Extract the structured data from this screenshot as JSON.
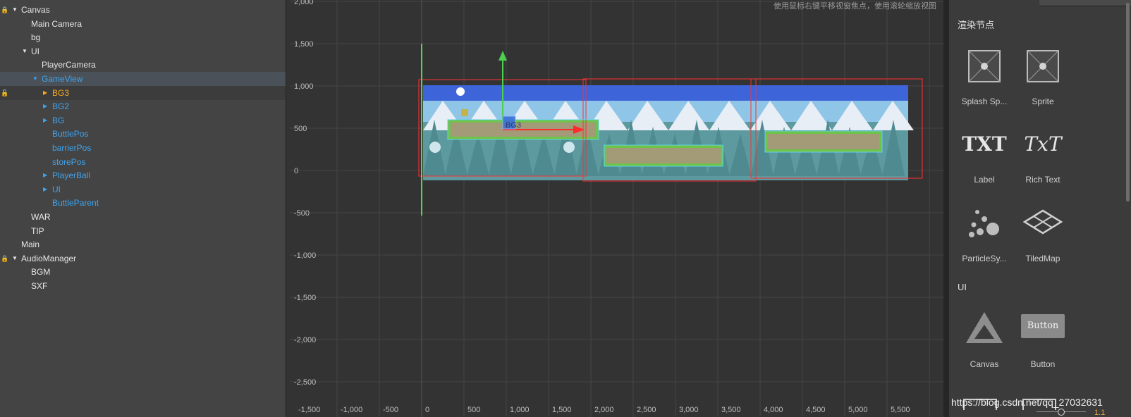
{
  "hierarchy": {
    "items": [
      {
        "label": "Canvas",
        "expanded": true,
        "locked": true
      },
      {
        "label": "Main Camera"
      },
      {
        "label": "bg"
      },
      {
        "label": "UI",
        "expanded": true
      },
      {
        "label": "PlayerCamera"
      },
      {
        "label": "GameView",
        "expanded": true
      },
      {
        "label": "BG3",
        "collapsed": true,
        "locked": true
      },
      {
        "label": "BG2",
        "collapsed": true
      },
      {
        "label": "BG",
        "collapsed": true
      },
      {
        "label": "ButtlePos"
      },
      {
        "label": "barrierPos"
      },
      {
        "label": "storePos"
      },
      {
        "label": "PlayerBall",
        "collapsed": true
      },
      {
        "label": "UI",
        "collapsed": true
      },
      {
        "label": "ButtleParent"
      },
      {
        "label": "WAR"
      },
      {
        "label": "TIP"
      },
      {
        "label": "Main"
      },
      {
        "label": "AudioManager",
        "expanded": true,
        "locked": true
      },
      {
        "label": "BGM"
      },
      {
        "label": "SXF"
      }
    ]
  },
  "scene": {
    "hint": "使用鼠标右键平移视窗焦点，使用滚轮缩放视图",
    "y_axis_labels": [
      "2,000",
      "1,500",
      "1,000",
      "500",
      "0",
      "-500",
      "-1,000",
      "-1,500",
      "-2,000",
      "-2,500"
    ],
    "x_axis_labels": [
      "-1,500",
      "-1,000",
      "-500",
      "0",
      "500",
      "1,000",
      "1,500",
      "2,000",
      "2,500",
      "3,000",
      "3,500",
      "4,000",
      "4,500",
      "5,000",
      "5,500"
    ],
    "selected_node_label": "BG3"
  },
  "widgets": {
    "render_section_title": "渲染节点",
    "render_items": [
      {
        "label": "Splash Sp...",
        "icon": "splash-sprite-icon"
      },
      {
        "label": "Sprite",
        "icon": "sprite-icon"
      },
      {
        "label": "Label",
        "icon": "label-txt-icon",
        "glyph": "TXT"
      },
      {
        "label": "Rich Text",
        "icon": "richtext-icon",
        "glyph": "TxT"
      },
      {
        "label": "ParticleSy...",
        "icon": "particle-system-icon"
      },
      {
        "label": "TiledMap",
        "icon": "tiledmap-icon"
      }
    ],
    "ui_section_title": "UI",
    "ui_items": [
      {
        "label": "Canvas",
        "icon": "canvas-triangle-icon"
      },
      {
        "label": "Button",
        "icon": "button-icon",
        "glyph": "Button"
      }
    ]
  },
  "watermark": "https://blog.csdn.net/qq_27032631",
  "zoom_value": "1.1",
  "colors": {
    "panel_bg": "#444444",
    "scene_bg": "#333333",
    "selected_text": "#f5a623",
    "child_text": "#3ea4f0",
    "normal_text": "#e6e6e6",
    "selection_box": "#ff3030",
    "y_gizmo": "#4fcf4f",
    "x_gizmo": "#ff2a2a"
  }
}
